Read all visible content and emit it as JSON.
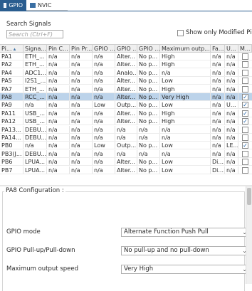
{
  "tabs": [
    {
      "label": "GPIO",
      "icon": "gpio-icon",
      "active": true
    },
    {
      "label": "NVIC",
      "icon": "nvic-icon",
      "active": false
    }
  ],
  "search": {
    "label": "Search Signals",
    "placeholder": "Search (Ctrl+F)",
    "show_modified_label": "Show only Modified Pins",
    "show_modified_checked": false
  },
  "table": {
    "columns": [
      "Pi...",
      "Signa...",
      "Pin C...",
      "Pin Pr...",
      "GPIO ...",
      "GPIO ...",
      "GPIO ...",
      "Maximum outp...",
      "Fa...",
      "U...",
      "M..."
    ],
    "rows": [
      {
        "cells": [
          "PA1",
          "ETH_...",
          "n/a",
          "n/a",
          "n/a",
          "Alter...",
          "No p...",
          "High",
          "n/a",
          "n/a"
        ],
        "modified": false,
        "selected": false
      },
      {
        "cells": [
          "PA2",
          "ETH_...",
          "n/a",
          "n/a",
          "n/a",
          "Alter...",
          "No p...",
          "High",
          "n/a",
          "n/a"
        ],
        "modified": false,
        "selected": false
      },
      {
        "cells": [
          "PA4",
          "ADC1...",
          "n/a",
          "n/a",
          "n/a",
          "Analo...",
          "No p...",
          "n/a",
          "n/a",
          "n/a"
        ],
        "modified": false,
        "selected": false
      },
      {
        "cells": [
          "PA5",
          "I2S1_...",
          "n/a",
          "n/a",
          "n/a",
          "Alter...",
          "No p...",
          "Low",
          "n/a",
          "n/a"
        ],
        "modified": false,
        "selected": false
      },
      {
        "cells": [
          "PA7",
          "ETH_...",
          "n/a",
          "n/a",
          "n/a",
          "Alter...",
          "No p...",
          "High",
          "n/a",
          "n/a"
        ],
        "modified": false,
        "selected": false
      },
      {
        "cells": [
          "PA8",
          "RCC_...",
          "n/a",
          "n/a",
          "n/a",
          "Alter...",
          "No p...",
          "Very High",
          "n/a",
          "n/a"
        ],
        "modified": true,
        "selected": true
      },
      {
        "cells": [
          "PA9",
          "n/a",
          "n/a",
          "n/a",
          "Low",
          "Outp...",
          "No p...",
          "Low",
          "n/a",
          "U..."
        ],
        "modified": true,
        "selected": false
      },
      {
        "cells": [
          "PA11",
          "USB_...",
          "n/a",
          "n/a",
          "n/a",
          "Alter...",
          "No p...",
          "High",
          "n/a",
          "n/a"
        ],
        "modified": true,
        "selected": false
      },
      {
        "cells": [
          "PA12",
          "USB_...",
          "n/a",
          "n/a",
          "n/a",
          "Alter...",
          "No p...",
          "High",
          "n/a",
          "n/a"
        ],
        "modified": true,
        "selected": false
      },
      {
        "cells": [
          "PA13...",
          "DEBU...",
          "n/a",
          "n/a",
          "n/a",
          "n/a",
          "n/a",
          "n/a",
          "n/a",
          "n/a"
        ],
        "modified": false,
        "selected": false
      },
      {
        "cells": [
          "PA14...",
          "DEBU...",
          "n/a",
          "n/a",
          "n/a",
          "n/a",
          "n/a",
          "n/a",
          "n/a",
          "n/a"
        ],
        "modified": false,
        "selected": false
      },
      {
        "cells": [
          "PB0",
          "n/a",
          "n/a",
          "n/a",
          "Low",
          "Outp...",
          "No p...",
          "Low",
          "n/a",
          "LE..."
        ],
        "modified": true,
        "selected": false
      },
      {
        "cells": [
          "PB3(J...",
          "DEBU...",
          "n/a",
          "n/a",
          "n/a",
          "n/a",
          "n/a",
          "n/a",
          "n/a",
          "n/a"
        ],
        "modified": false,
        "selected": false
      },
      {
        "cells": [
          "PB6",
          "LPUA...",
          "n/a",
          "n/a",
          "n/a",
          "Alter...",
          "No p...",
          "Low",
          "Di...",
          "n/a"
        ],
        "modified": false,
        "selected": false
      },
      {
        "cells": [
          "PB7",
          "LPUA...",
          "n/a",
          "n/a",
          "n/a",
          "Alter...",
          "No p...",
          "Low",
          "Di...",
          "n/a"
        ],
        "modified": false,
        "selected": false
      }
    ]
  },
  "config": {
    "title": "PA8 Configuration :",
    "fields": [
      {
        "label": "GPIO mode",
        "value": "Alternate Function Push Pull"
      },
      {
        "label": "GPIO Pull-up/Pull-down",
        "value": "No pull-up and no pull-down"
      },
      {
        "label": "Maximum output speed",
        "value": "Very High"
      }
    ]
  },
  "colors": {
    "tab_active": "#2a5d8f",
    "row_selected": "#bcd3ea",
    "check": "#1b5fa8"
  }
}
